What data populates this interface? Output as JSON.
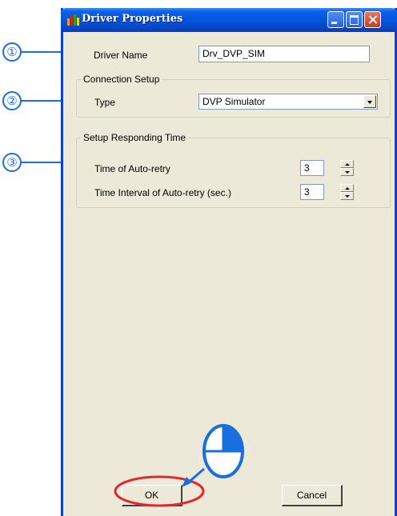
{
  "window": {
    "title": "Driver Properties"
  },
  "form": {
    "driver_name_label": "Driver Name",
    "driver_name_value": "Drv_DVP_SIM",
    "connection_group_title": "Connection Setup",
    "type_label": "Type",
    "type_value": "DVP Simulator",
    "responding_group_title": "Setup Responding Time",
    "auto_retry_label": "Time of Auto-retry",
    "auto_retry_value": "3",
    "interval_label": "Time Interval of Auto-retry (sec.)",
    "interval_value": "3"
  },
  "buttons": {
    "ok_label": "OK",
    "cancel_label": "Cancel"
  },
  "annotations": {
    "marker_1": "①",
    "marker_2": "②",
    "marker_3": "③"
  },
  "colors": {
    "titlebar": "#0654de",
    "window_bg": "#ece9d8",
    "annotation_blue": "#1a6fe0",
    "highlight_red": "#e0282e"
  },
  "icons": {
    "app_icon": "driver-app-icon",
    "mouse_icon": "mouse-click-icon"
  }
}
